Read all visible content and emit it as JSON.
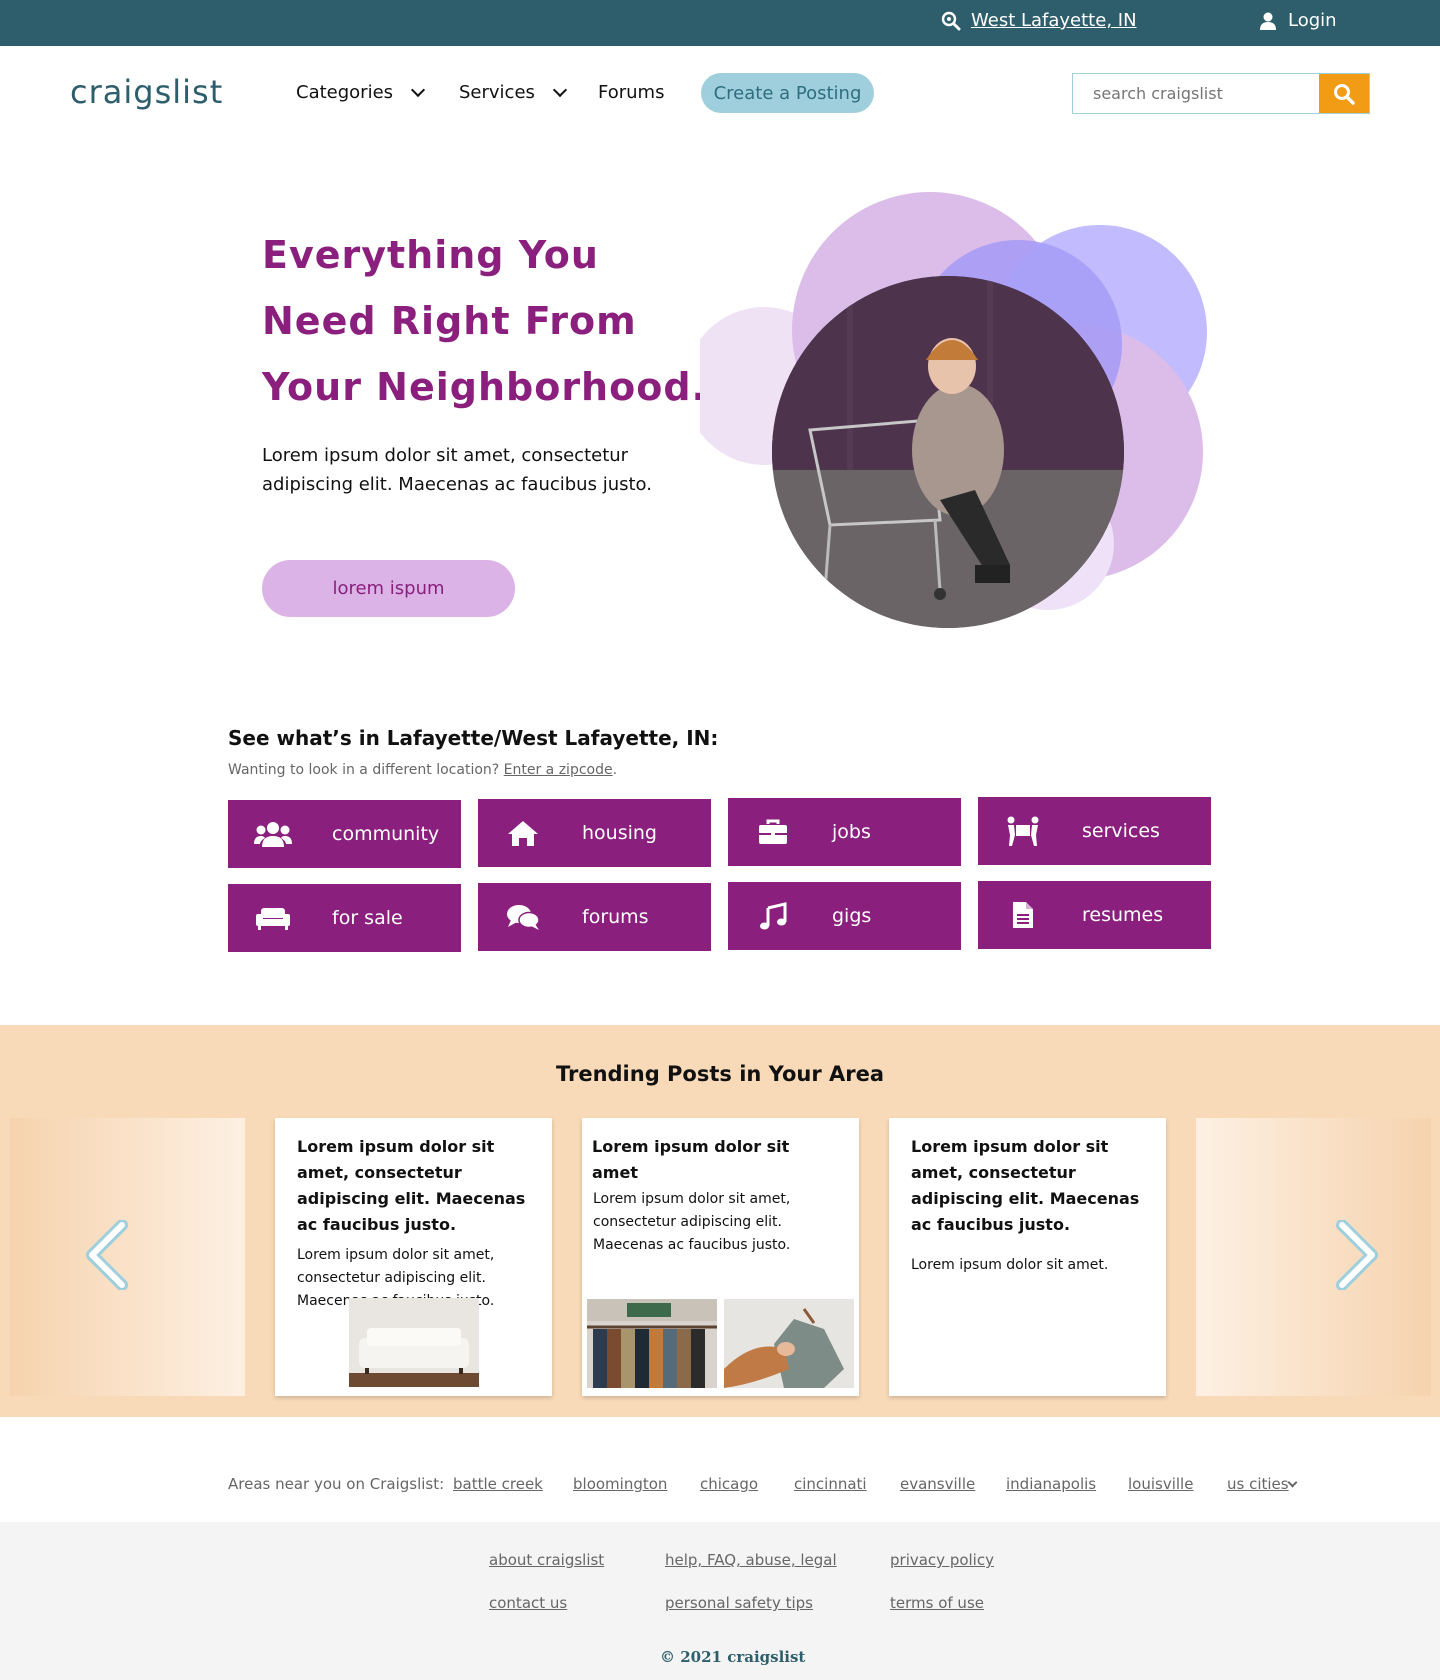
{
  "topbar": {
    "location": "West Lafayette, IN",
    "login": "Login"
  },
  "header": {
    "logo": "craigslist",
    "nav": [
      "Categories",
      "Services",
      "Forums"
    ],
    "create_posting": "Create a Posting",
    "search_placeholder": "search craigslist"
  },
  "hero": {
    "headline": "Everything You Need Right From Your Neighborhood.",
    "body": "Lorem ipsum dolor sit amet, consectetur adipiscing elit. Maecenas ac faucibus justo.",
    "button": "lorem ispum"
  },
  "local": {
    "title": "See what’s in Lafayette/West Lafayette, IN:",
    "subtitle_prefix": "Wanting to look in a different location?",
    "subtitle_link": "Enter a zipcode",
    "categories": [
      {
        "label": "community",
        "icon": "users-icon"
      },
      {
        "label": "housing",
        "icon": "home-icon"
      },
      {
        "label": "jobs",
        "icon": "briefcase-icon"
      },
      {
        "label": "services",
        "icon": "people-carry-icon"
      },
      {
        "label": "for sale",
        "icon": "couch-icon"
      },
      {
        "label": "forums",
        "icon": "comments-icon"
      },
      {
        "label": "gigs",
        "icon": "music-icon"
      },
      {
        "label": "resumes",
        "icon": "file-icon"
      }
    ]
  },
  "trending": {
    "title": "Trending Posts in Your Area",
    "cards": [
      {
        "title": "Lorem ipsum dolor sit amet, consectetur adipiscing elit. Maecenas ac faucibus justo.",
        "body": "Lorem ipsum dolor sit amet, consectetur adipiscing elit. Maecenas ac faucibus justo."
      },
      {
        "title": "Lorem ipsum dolor sit amet",
        "body": "Lorem ipsum dolor sit amet, consectetur adipiscing elit. Maecenas ac faucibus justo."
      },
      {
        "title": "Lorem ipsum dolor sit amet, consectetur adipiscing elit. Maecenas ac faucibus justo.",
        "body": "Lorem ipsum dolor sit amet."
      }
    ]
  },
  "nearby": {
    "label": "Areas near you on Craigslist:",
    "cities": [
      "battle creek",
      "bloomington",
      "chicago",
      "cincinnati",
      "evansville",
      "indianapolis",
      "louisville",
      "us cities"
    ]
  },
  "footer": {
    "links": [
      "about craigslist",
      "help, FAQ, abuse, legal",
      "privacy policy",
      "contact us",
      "personal safety tips",
      "terms of use"
    ],
    "copyright": "©  2021 craigslist"
  },
  "colors": {
    "brand": "#8a1f7d",
    "topbar": "#2e5e6b",
    "accent": "#f29c15",
    "trend_bg": "#f8dab8"
  }
}
